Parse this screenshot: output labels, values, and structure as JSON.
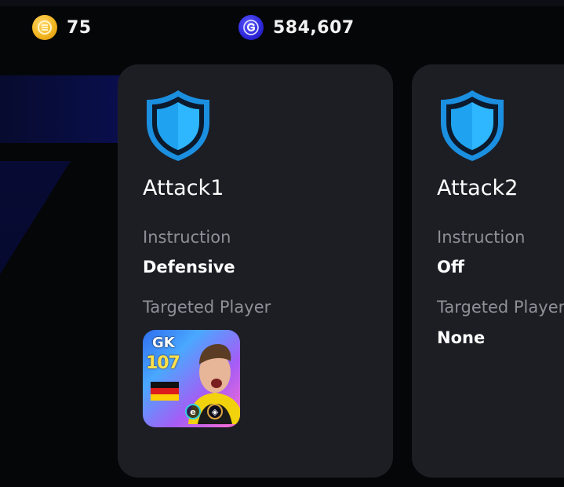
{
  "currencies": {
    "coins": {
      "value": "75",
      "icon": "ecoin-icon",
      "color": "#f2b51f"
    },
    "gp": {
      "value": "584,607",
      "icon": "gp-icon",
      "color": "#2d27d8"
    }
  },
  "cards": [
    {
      "title": "Attack1",
      "icon": "shield-icon",
      "instruction_label": "Instruction",
      "instruction_value": "Defensive",
      "target_label": "Targeted Player",
      "target_player": {
        "position": "GK",
        "rating": "107",
        "nation_flag": "germany-flag",
        "badges": [
          "epic-badge-icon",
          "booster-badge-icon"
        ]
      }
    },
    {
      "title": "Attack2",
      "icon": "shield-icon",
      "instruction_label": "Instruction",
      "instruction_value": "Off",
      "target_label": "Targeted Player",
      "target_value": "None"
    }
  ],
  "colors": {
    "background": "#050608",
    "card": "#1d1e24",
    "shield": "#1aa7f2",
    "label": "#8e9097"
  }
}
